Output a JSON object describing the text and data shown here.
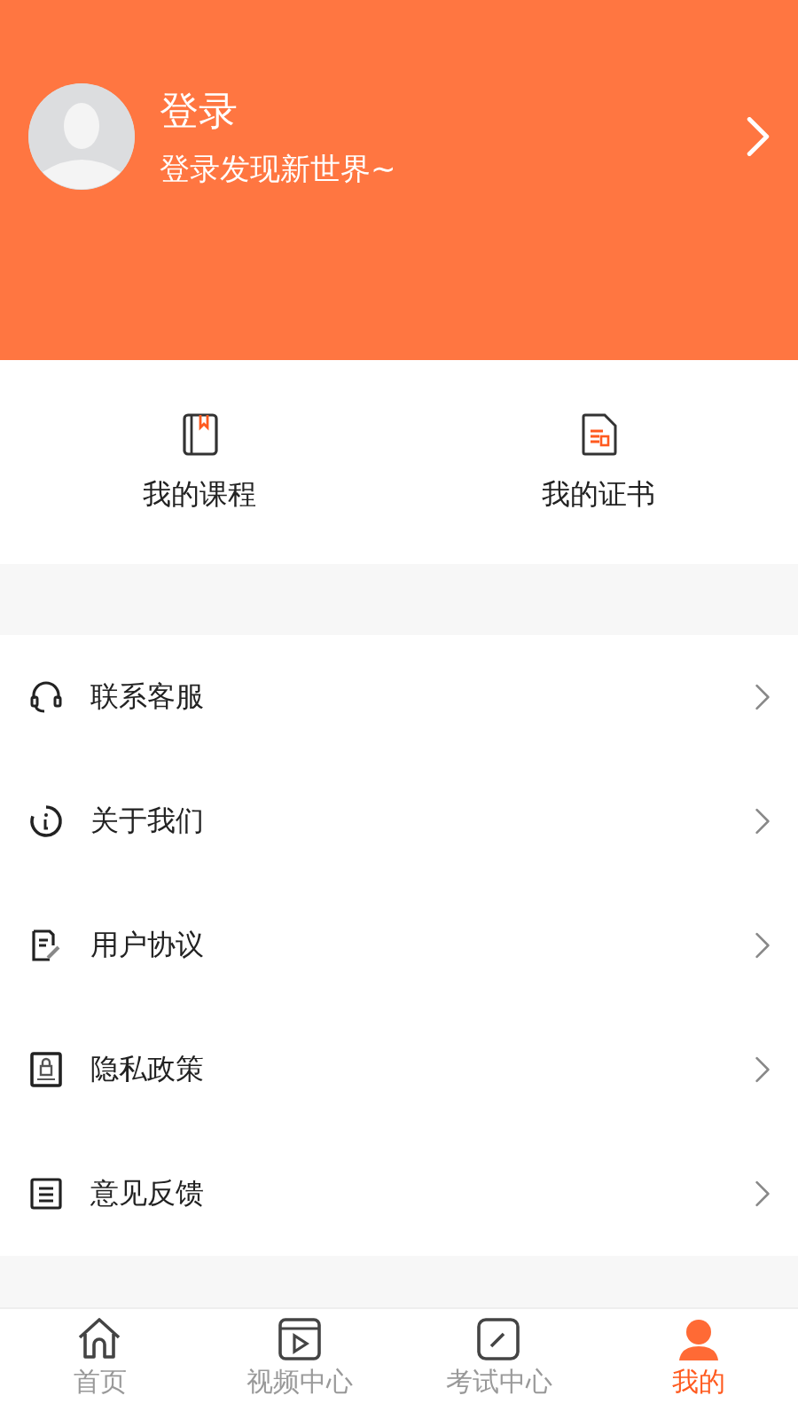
{
  "profile": {
    "title": "登录",
    "subtitle": "登录发现新世界~"
  },
  "shortcuts": [
    {
      "label": "我的课程"
    },
    {
      "label": "我的证书"
    }
  ],
  "menu": [
    {
      "label": "联系客服"
    },
    {
      "label": "关于我们"
    },
    {
      "label": "用户协议"
    },
    {
      "label": "隐私政策"
    },
    {
      "label": "意见反馈"
    }
  ],
  "tabs": [
    {
      "label": "首页",
      "selected": false
    },
    {
      "label": "视频中心",
      "selected": false
    },
    {
      "label": "考试中心",
      "selected": false
    },
    {
      "label": "我的",
      "selected": true
    }
  ]
}
